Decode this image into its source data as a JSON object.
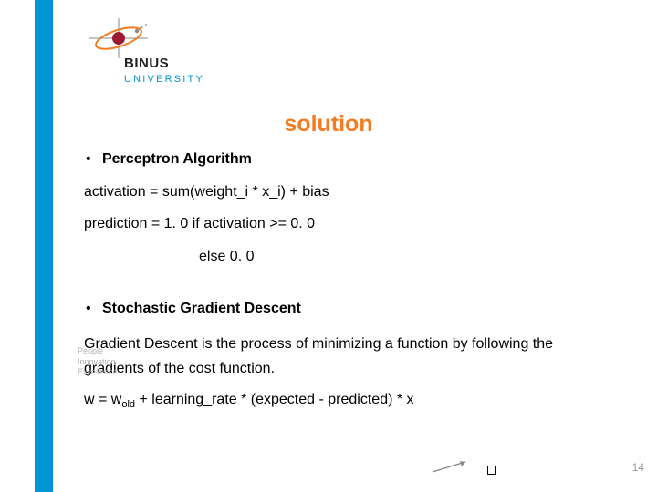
{
  "logo": {
    "brand_top": "BINUS",
    "brand_bottom": "UNIVERSITY"
  },
  "title": "solution",
  "sidebar_small": {
    "l1": "People",
    "l2": "Innovation",
    "l3": "Excellence"
  },
  "b1": {
    "dot": "•",
    "label": "Perceptron Algorithm"
  },
  "line1": "activation = sum(weight_i * x_i) + bias",
  "line2": "prediction = 1. 0 if activation >= 0. 0",
  "line3": "else 0. 0",
  "b2": {
    "dot": "•",
    "label": "Stochastic Gradient Descent"
  },
  "para": "Gradient Descent is the process of minimizing a function by following the gradients of the cost function.",
  "formula": {
    "pre": "w = w",
    "sub": "old",
    "post": " + learning_rate * (expected - predicted) * x"
  },
  "page_number": "14"
}
